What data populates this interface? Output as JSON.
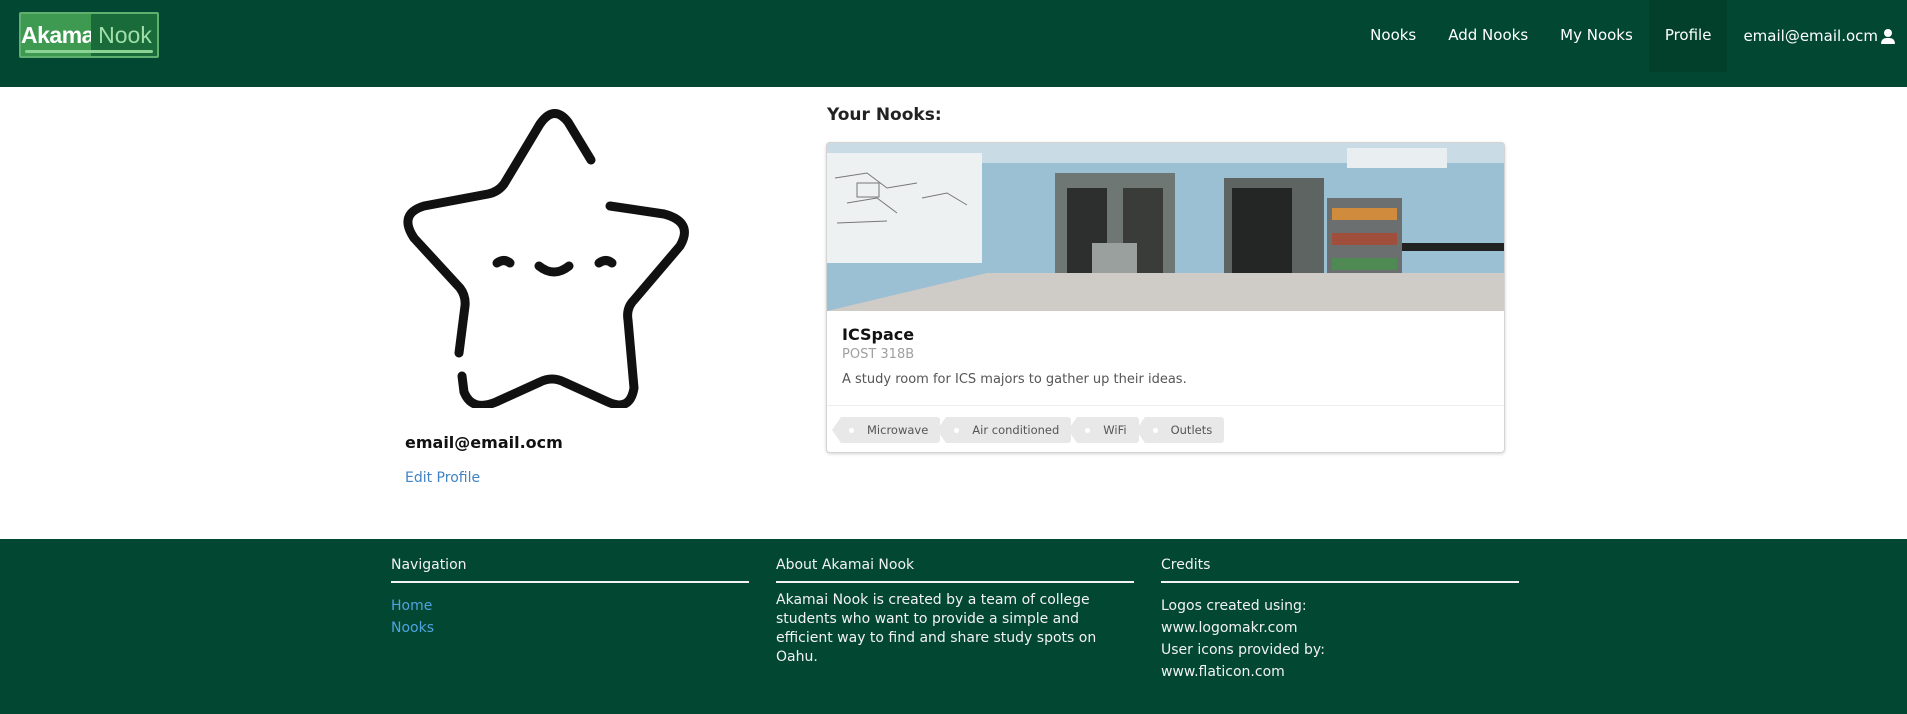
{
  "navbar": {
    "logo": {
      "left_text": "Akamai",
      "right_text": "Nook"
    },
    "items": [
      {
        "label": "Nooks"
      },
      {
        "label": "Add Nooks"
      },
      {
        "label": "My Nooks"
      },
      {
        "label": "Profile",
        "active": true
      }
    ],
    "user_email": "email@email.ocm",
    "user_icon": "user-icon"
  },
  "profile": {
    "avatar_icon": "star-face-avatar",
    "email": "email@email.ocm",
    "edit_label": "Edit Profile"
  },
  "your_nooks": {
    "title": "Your Nooks:",
    "cards": [
      {
        "name": "ICSpace",
        "location": "POST 318B",
        "description": "A study room for ICS majors to gather up their ideas.",
        "tags": [
          "Microwave",
          "Air conditioned",
          "WiFi",
          "Outlets"
        ]
      }
    ]
  },
  "footer": {
    "navigation": {
      "heading": "Navigation",
      "links": [
        "Home",
        "Nooks"
      ]
    },
    "about": {
      "heading": "About Akamai Nook",
      "text": "Akamai Nook is created by a team of college students who want to provide a simple and efficient way to find and share study spots on Oahu."
    },
    "credits": {
      "heading": "Credits",
      "lines": [
        "Logos created using:",
        "www.logomakr.com",
        "User icons provided by:",
        "www.flaticon.com"
      ]
    }
  },
  "colors": {
    "brand_dark_green": "#024731",
    "link_blue": "#4183c4",
    "footer_link_blue": "#4fa3e0"
  }
}
